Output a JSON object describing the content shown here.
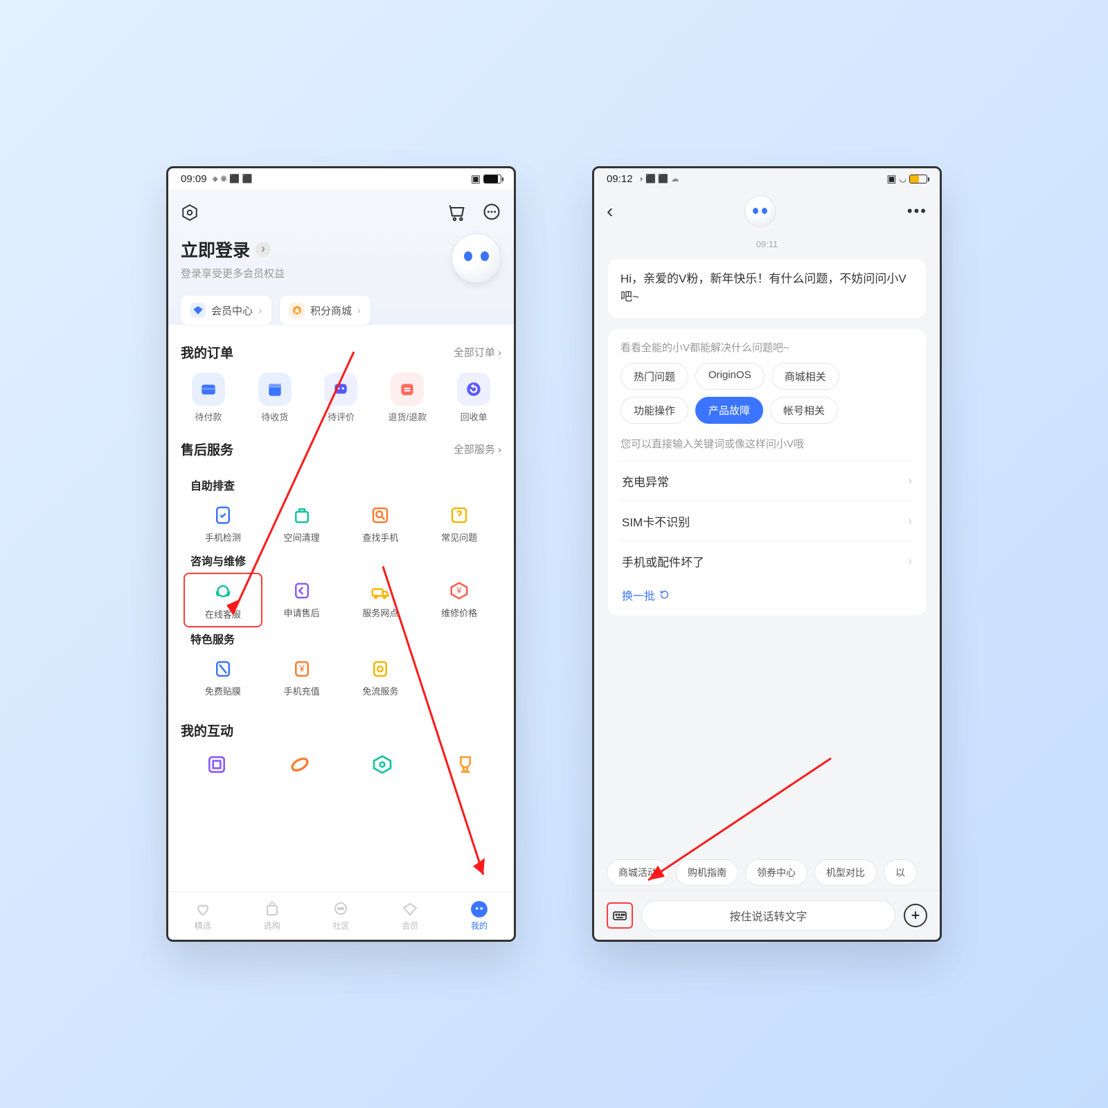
{
  "screen1": {
    "status": {
      "time": "09:09",
      "indicators": "⬥ ◉ ⬛ ⬛"
    },
    "login": {
      "title": "立即登录",
      "subtitle": "登录享受更多会员权益"
    },
    "chips": [
      {
        "label": "会员中心"
      },
      {
        "label": "积分商城"
      }
    ],
    "orders": {
      "title": "我的订单",
      "more": "全部订单",
      "items": [
        "待付款",
        "待收货",
        "待评价",
        "退货/退款",
        "回收单"
      ]
    },
    "service": {
      "title": "售后服务",
      "more": "全部服务",
      "groups": [
        {
          "heading": "自助排查",
          "items": [
            "手机检测",
            "空间清理",
            "查找手机",
            "常见问题"
          ]
        },
        {
          "heading": "咨询与维修",
          "items": [
            "在线客服",
            "申请售后",
            "服务网点",
            "维修价格"
          ]
        },
        {
          "heading": "特色服务",
          "items": [
            "免费贴膜",
            "手机充值",
            "免流服务"
          ]
        }
      ]
    },
    "interact": {
      "title": "我的互动"
    },
    "tabs": [
      "精选",
      "选购",
      "社区",
      "会员",
      "我的"
    ]
  },
  "screen2": {
    "status": {
      "time": "09:12",
      "indicators": "◑ ⬛ ⬛ ☁"
    },
    "chat_time": "09:11",
    "greeting": "Hi，亲爱的V粉，新年快乐！有什么问题，不妨问问小V吧~",
    "panel_hint1": "看看全能的小V都能解决什么问题吧~",
    "topics": [
      "热门问题",
      "OriginOS",
      "商城相关",
      "功能操作",
      "产品故障",
      "帐号相关"
    ],
    "active_topic_index": 4,
    "panel_hint2": "您可以直接输入关键词或像这样问小V哦",
    "questions": [
      "充电异常",
      "SIM卡不识别",
      "手机或配件坏了"
    ],
    "refresh": "换一批",
    "suggestions": [
      "商城活动",
      "购机指南",
      "领券中心",
      "机型对比",
      "以"
    ],
    "voice_hint": "按住说话转文字"
  }
}
